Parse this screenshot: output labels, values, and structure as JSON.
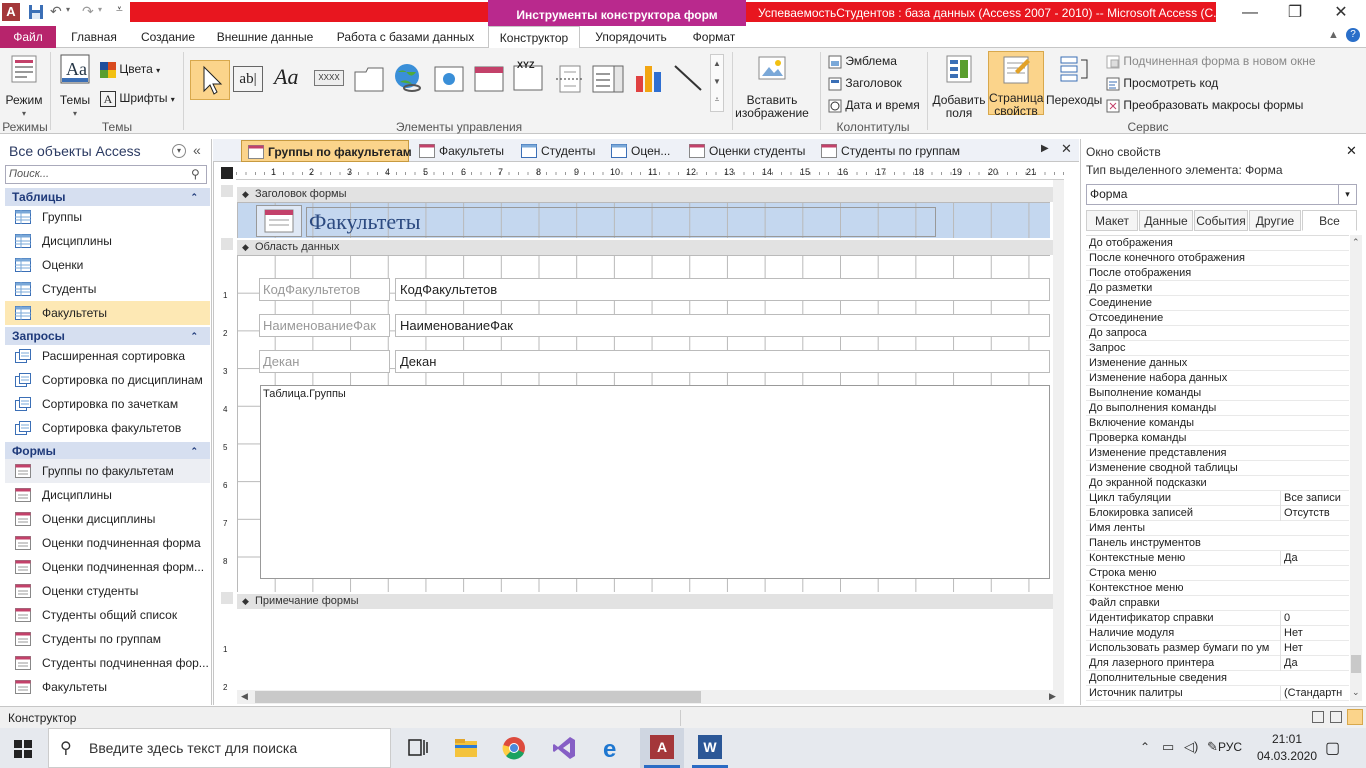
{
  "title_bar": {
    "context_tab": "Инструменты конструктора форм",
    "title": "УспеваемостьСтудентов : база данных (Access 2007 - 2010) -- Microsoft Access (С..."
  },
  "ribbon_tabs": [
    "Файл",
    "Главная",
    "Создание",
    "Внешние данные",
    "Работа с базами данных",
    "Конструктор",
    "Упорядочить",
    "Формат"
  ],
  "ribbon": {
    "view": "Режим",
    "themes": "Темы",
    "colors": "Цвета",
    "fonts": "Шрифты",
    "insert_image": "Вставить изображение",
    "logo": "Эмблема",
    "header_title": "Заголовок",
    "date_time": "Дата и время",
    "add_fields": "Добавить поля",
    "property_sheet": "Страница свойств",
    "tab_order": "Переходы",
    "subform_new_window": "Подчиненная форма в новом окне",
    "view_code": "Просмотреть код",
    "convert_macros": "Преобразовать макросы формы",
    "groups": {
      "modes": "Режимы",
      "themes": "Темы",
      "controls": "Элементы управления",
      "header_footer": "Колонтитулы",
      "tools": "Сервис"
    }
  },
  "nav": {
    "header": "Все объекты Access",
    "search_placeholder": "Поиск...",
    "sections": [
      {
        "title": "Таблицы",
        "items": [
          "Группы",
          "Дисциплины",
          "Оценки",
          "Студенты",
          "Факультеты"
        ]
      },
      {
        "title": "Запросы",
        "items": [
          "Расширенная сортировка",
          "Сортировка по дисциплинам",
          "Сортировка по зачеткам",
          "Сортировка факультетов"
        ]
      },
      {
        "title": "Формы",
        "items": [
          "Группы по факультетам",
          "Дисциплины",
          "Оценки дисциплины",
          "Оценки подчиненная форма",
          "Оценки подчиненная форм...",
          "Оценки студенты",
          "Студенты общий список",
          "Студенты по группам",
          "Студенты подчиненная фор...",
          "Факультеты"
        ]
      }
    ]
  },
  "doc_tabs": [
    "Группы по факультетам",
    "Факультеты",
    "Студенты",
    "Оцен...",
    "Оценки студенты",
    "Студенты по группам"
  ],
  "designer": {
    "header_section": "Заголовок формы",
    "form_title": "Факультеты",
    "detail_section": "Область данных",
    "footer_section": "Примечание формы",
    "labels": [
      "КодФакультетов",
      "НаименованиеФак",
      "Декан"
    ],
    "fields": [
      "КодФакультетов",
      "НаименованиеФак",
      "Декан"
    ],
    "subform": "Таблица.Группы",
    "ruler": [
      "1",
      "2",
      "3",
      "4",
      "5",
      "6",
      "7",
      "8",
      "9",
      "10",
      "11",
      "12",
      "13",
      "14",
      "15",
      "16",
      "17",
      "18",
      "19",
      "20",
      "21"
    ]
  },
  "props": {
    "title": "Окно свойств",
    "selection_type": "Тип выделенного элемента:  Форма",
    "selected": "Форма",
    "tabs": [
      "Макет",
      "Данные",
      "События",
      "Другие",
      "Все"
    ],
    "rows": [
      [
        "До отображения",
        ""
      ],
      [
        "После конечного отображения",
        ""
      ],
      [
        "После отображения",
        ""
      ],
      [
        "До разметки",
        ""
      ],
      [
        "Соединение",
        ""
      ],
      [
        "Отсоединение",
        ""
      ],
      [
        "До запроса",
        ""
      ],
      [
        "Запрос",
        ""
      ],
      [
        "Изменение данных",
        ""
      ],
      [
        "Изменение набора данных",
        ""
      ],
      [
        "Выполнение команды",
        ""
      ],
      [
        "До выполнения команды",
        ""
      ],
      [
        "Включение команды",
        ""
      ],
      [
        "Проверка команды",
        ""
      ],
      [
        "Изменение представления",
        ""
      ],
      [
        "Изменение сводной таблицы",
        ""
      ],
      [
        "До экранной подсказки",
        ""
      ],
      [
        "Цикл табуляции",
        "Все записи"
      ],
      [
        "Блокировка записей",
        "Отсутств"
      ],
      [
        "Имя ленты",
        ""
      ],
      [
        "Панель инструментов",
        ""
      ],
      [
        "Контекстные меню",
        "Да"
      ],
      [
        "Строка меню",
        ""
      ],
      [
        "Контекстное меню",
        ""
      ],
      [
        "Файл справки",
        ""
      ],
      [
        "Идентификатор справки",
        "0"
      ],
      [
        "Наличие модуля",
        "Нет"
      ],
      [
        "Использовать размер бумаги по ум",
        "Нет"
      ],
      [
        "Для лазерного принтера",
        "Да"
      ],
      [
        "Дополнительные сведения",
        ""
      ],
      [
        "Источник палитры",
        "(Стандартн"
      ]
    ]
  },
  "status": "Конструктор",
  "taskbar": {
    "search_placeholder": "Введите здесь текст для поиска",
    "lang": "РУС",
    "time": "21:01",
    "date": "04.03.2020"
  }
}
